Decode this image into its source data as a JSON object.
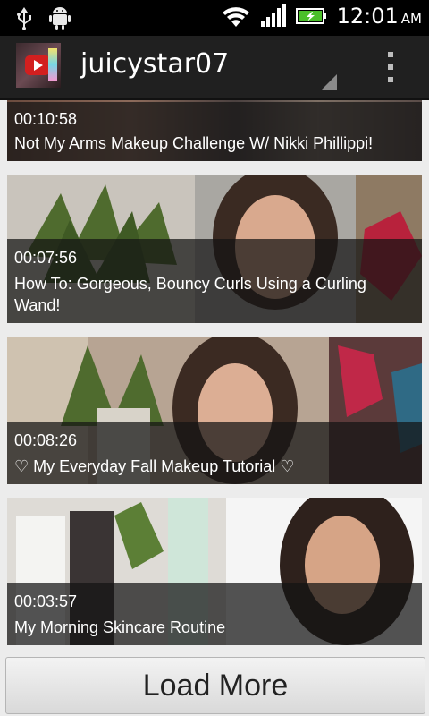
{
  "status_bar": {
    "time": "12:01",
    "ampm": "AM",
    "icons": [
      "usb-icon",
      "android-debug-icon",
      "wifi-icon",
      "signal-icon",
      "battery-charging-icon"
    ]
  },
  "action_bar": {
    "channel_name": "juicystar07"
  },
  "videos": [
    {
      "duration": "00:10:58",
      "title": "Not My Arms Makeup Challenge W/ Nikki Phillippi!"
    },
    {
      "duration": "00:07:56",
      "title": "How To: Gorgeous, Bouncy Curls Using a Curling Wand!"
    },
    {
      "duration": "00:08:26",
      "title": "♡ My Everyday Fall Makeup Tutorial ♡"
    },
    {
      "duration": "00:03:57",
      "title": "My Morning Skincare Routine"
    }
  ],
  "footer": {
    "load_more_label": "Load More"
  }
}
